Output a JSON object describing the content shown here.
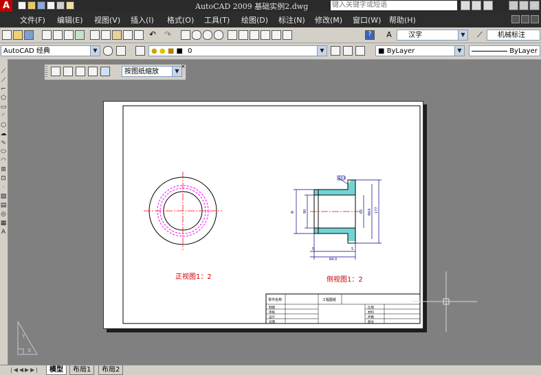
{
  "window": {
    "title": "AutoCAD 2009  基础实例2.dwg",
    "search_placeholder": "键入关键字或短语"
  },
  "menu": {
    "items": [
      {
        "label": "文件(F)"
      },
      {
        "label": "编辑(E)"
      },
      {
        "label": "视图(V)"
      },
      {
        "label": "插入(I)"
      },
      {
        "label": "格式(O)"
      },
      {
        "label": "工具(T)"
      },
      {
        "label": "绘图(D)"
      },
      {
        "label": "标注(N)"
      },
      {
        "label": "修改(M)"
      },
      {
        "label": "窗口(W)"
      },
      {
        "label": "帮助(H)"
      }
    ]
  },
  "toolbar1": {
    "text_style": "汉字",
    "dim_style": "机械标注"
  },
  "toolbar2": {
    "workspace": "AutoCAD 经典",
    "layer": "0",
    "color": "ByLayer",
    "linetype": "ByLayer"
  },
  "viewport_toolbar": {
    "scale": "按图纸缩放"
  },
  "drawing": {
    "front_view_label": "正视图1：2",
    "side_view_label": "侧视图1：2",
    "dims": {
      "top_label": "R0.5",
      "d1": "Φ",
      "d2": "90",
      "d3": "65",
      "d4": "Φ64",
      "d5": "177",
      "bottom_left": "5",
      "bottom_mid": "5",
      "bottom_total": "84.0"
    },
    "title_block": {
      "row1_left": "零件名称",
      "row1_mid": "工程图纸",
      "cells_left": [
        "制图",
        "审核",
        "设计",
        "日期"
      ],
      "cells_right": [
        "比例",
        "材料",
        "件数",
        "图号"
      ]
    }
  },
  "layout_tabs": [
    {
      "label": "模型"
    },
    {
      "label": "布局1"
    },
    {
      "label": "布局2"
    }
  ],
  "colors": {
    "center_line": "#ff0000",
    "hidden_line": "#ff00ff",
    "object_line": "#000080",
    "hatch": "#00b0b0",
    "label_red": "#d00000"
  }
}
